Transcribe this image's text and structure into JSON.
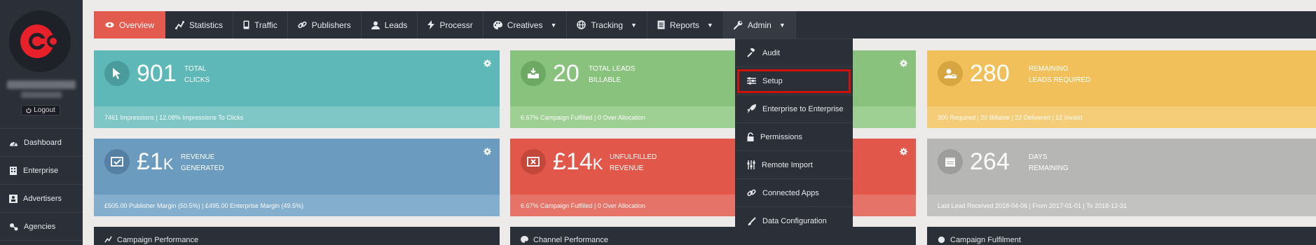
{
  "sidebar": {
    "logout_label": "Logout",
    "items": [
      {
        "label": "Dashboard",
        "icon": "dashboard-icon"
      },
      {
        "label": "Enterprise",
        "icon": "building-icon"
      },
      {
        "label": "Advertisers",
        "icon": "id-card-icon"
      },
      {
        "label": "Agencies",
        "icon": "sitemap-icon"
      }
    ]
  },
  "topnav": {
    "items": [
      {
        "label": "Overview",
        "icon": "eye-icon"
      },
      {
        "label": "Statistics",
        "icon": "chart-line-icon"
      },
      {
        "label": "Traffic",
        "icon": "mobile-icon"
      },
      {
        "label": "Publishers",
        "icon": "link-icon"
      },
      {
        "label": "Leads",
        "icon": "user-icon"
      },
      {
        "label": "Processr",
        "icon": "bolt-icon"
      },
      {
        "label": "Creatives",
        "icon": "palette-icon"
      },
      {
        "label": "Tracking",
        "icon": "globe-icon"
      },
      {
        "label": "Reports",
        "icon": "report-icon"
      },
      {
        "label": "Admin",
        "icon": "wrench-icon"
      }
    ]
  },
  "cards": {
    "clicks": {
      "value": "901",
      "label1": "TOTAL",
      "label2": "CLICKS",
      "footer": "7461 Impressions | 12.08% Impressions To Clicks"
    },
    "leads": {
      "value": "20",
      "label1": "TOTAL LEADS",
      "label2": "BILLABLE",
      "footer": "6.67% Campaign Fulfilled | 0 Over Allocation"
    },
    "remaining": {
      "value": "280",
      "label1": "REMAINING",
      "label2": "LEADS REQUIRED",
      "footer": "300 Required | 20 Billable | 22 Delivered | 12 Invalid"
    },
    "revenue": {
      "value": "£1",
      "unit": "K",
      "label1": "REVENUE",
      "label2": "GENERATED",
      "footer": "£505.00 Publisher Margin (50.5%) | £495.00 Enterprise Margin (49.5%)"
    },
    "unfulfilled": {
      "value": "£14",
      "unit": "K",
      "label1": "UNFULFILLED",
      "label2": "REVENUE",
      "footer": "6.67% Campaign Fulfilled | 0 Over Allocation"
    },
    "days": {
      "value": "264",
      "label1": "DAYS",
      "label2": "REMAINING",
      "footer": "Last Lead Received 2018-04-06 | From 2017-01-01 | To 2018-12-31"
    }
  },
  "panels": [
    {
      "title": "Campaign Performance",
      "icon": "chart-line-icon"
    },
    {
      "title": "Channel Performance",
      "icon": "palette-icon"
    },
    {
      "title": "Campaign Fulfilment",
      "icon": "globe-icon"
    }
  ],
  "admin_menu": {
    "items": [
      {
        "label": "Audit",
        "icon": "gavel-icon"
      },
      {
        "label": "Setup",
        "icon": "sliders-icon",
        "highlighted": true
      },
      {
        "label": "Enterprise to Enterprise",
        "icon": "rocket-icon"
      },
      {
        "label": "Permissions",
        "icon": "lock-icon"
      },
      {
        "label": "Remote Import",
        "icon": "sliders-vertical-icon"
      },
      {
        "label": "Connected Apps",
        "icon": "link-icon"
      },
      {
        "label": "Data Configuration",
        "icon": "brush-icon"
      }
    ]
  },
  "colors": {
    "accent": "#e35a4e",
    "nav_bg": "#2b2f37",
    "teal": "#5fb8b8",
    "green": "#89c27d",
    "yellow": "#f1c05a",
    "blue": "#6b9bbf",
    "red": "#e1574a",
    "gray": "#b6b6b4",
    "highlight_box": "#d10f0f"
  }
}
